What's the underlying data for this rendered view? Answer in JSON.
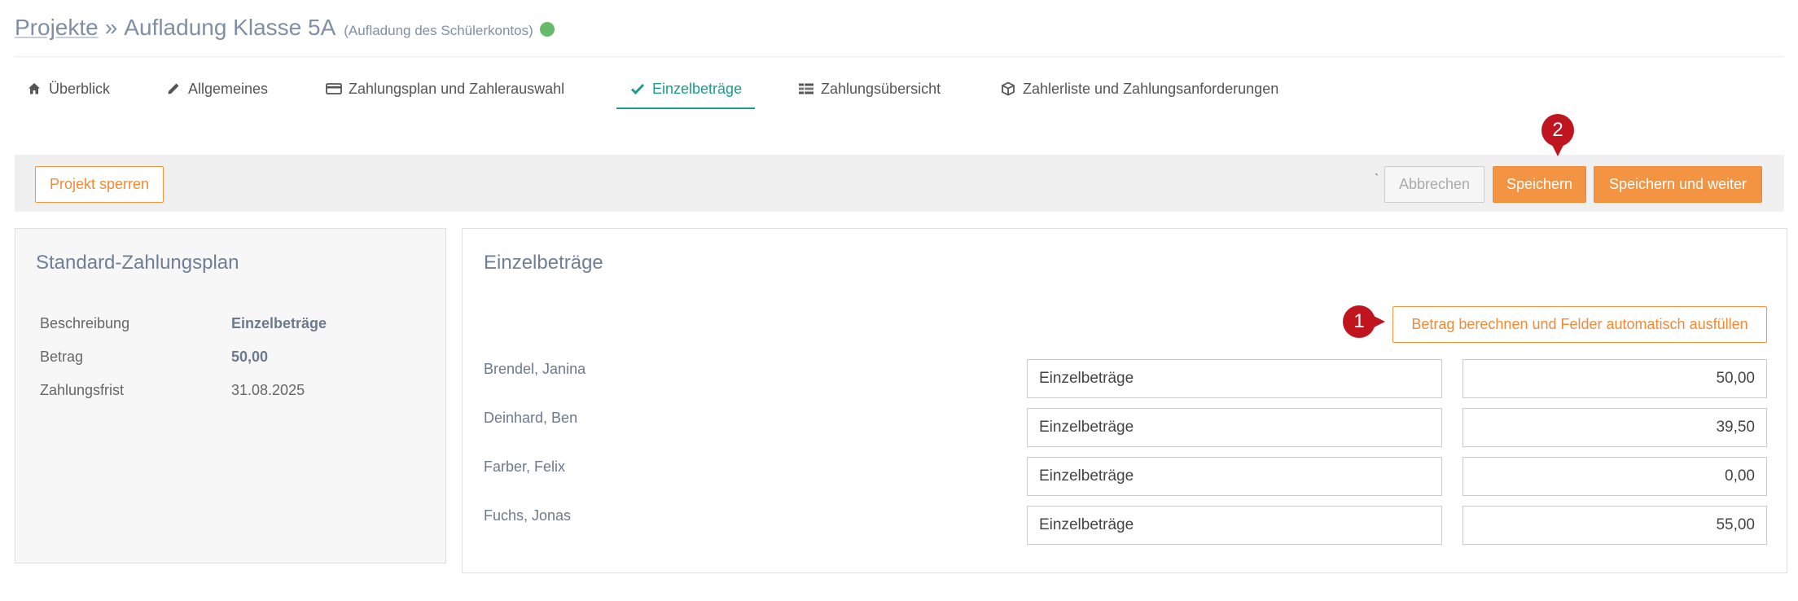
{
  "header": {
    "breadcrumb_root": "Projekte",
    "separator": "»",
    "project_title": "Aufladung Klasse 5A",
    "project_subtitle": "(Aufladung des Schülerkontos)",
    "status_color": "#66bb6a"
  },
  "tabs": [
    {
      "label": "Überblick",
      "icon": "home-icon"
    },
    {
      "label": "Allgemeines",
      "icon": "pencil-icon"
    },
    {
      "label": "Zahlungsplan und Zahlerauswahl",
      "icon": "credit-card-icon"
    },
    {
      "label": "Einzelbeträge",
      "icon": "checkmark-icon",
      "active": true
    },
    {
      "label": "Zahlungsübersicht",
      "icon": "list-icon"
    },
    {
      "label": "Zahlerliste und Zahlungsanforderungen",
      "icon": "cube-icon"
    }
  ],
  "toolbar": {
    "lock_label": "Projekt sperren",
    "tick": "`",
    "cancel_label": "Abbrechen",
    "save_label": "Speichern",
    "save_next_label": "Speichern und weiter"
  },
  "standard_plan": {
    "title": "Standard-Zahlungsplan",
    "rows": [
      {
        "label": "Beschreibung",
        "value": "Einzelbeträge"
      },
      {
        "label": "Betrag",
        "value": "50,00"
      },
      {
        "label": "Zahlungsfrist",
        "value": "31.08.2025"
      }
    ]
  },
  "einzelbetraege": {
    "title": "Einzelbeträge",
    "autofill_label": "Betrag berechnen und Felder automatisch ausfüllen",
    "payers": [
      {
        "name": "Brendel, Janina",
        "description": "Einzelbeträge",
        "amount": "50,00"
      },
      {
        "name": "Deinhard, Ben",
        "description": "Einzelbeträge",
        "amount": "39,50"
      },
      {
        "name": "Farber, Felix",
        "description": "Einzelbeträge",
        "amount": "0,00"
      },
      {
        "name": "Fuchs, Jonas",
        "description": "Einzelbeträge",
        "amount": "55,00"
      }
    ]
  },
  "markers": {
    "first": "1",
    "second": "2"
  },
  "colors": {
    "accent_orange": "#f39443",
    "active_teal": "#1a9c8f",
    "marker_red": "#c0141f"
  }
}
